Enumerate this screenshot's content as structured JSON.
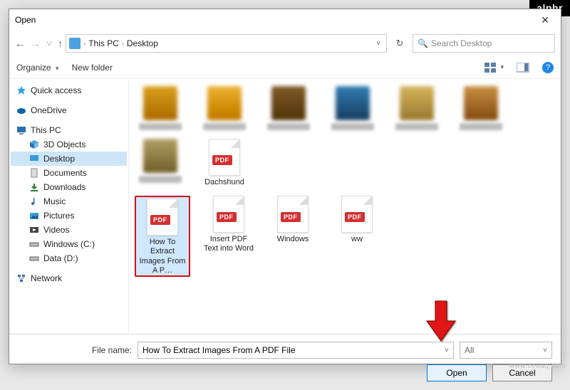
{
  "watermarks": {
    "alphr": "alphr",
    "site": "www.ceuaq.com"
  },
  "window": {
    "title": "Open"
  },
  "nav": {
    "path_icon": "monitor",
    "crumbs": [
      "This PC",
      "Desktop"
    ],
    "refresh_icon": "refresh"
  },
  "search": {
    "placeholder": "Search Desktop",
    "icon": "search-icon"
  },
  "toolbar": {
    "organize": "Organize",
    "new_folder": "New folder",
    "view_icon": "view-options",
    "preview_icon": "preview-pane",
    "help_icon": "?",
    "organize_caret": "▾"
  },
  "sidebar": {
    "groups": [
      {
        "icon": "star",
        "label": "Quick access",
        "color": "#2e87d4"
      },
      {
        "icon": "cloud",
        "label": "OneDrive",
        "color": "#0a63a8"
      },
      {
        "icon": "pc",
        "label": "This PC",
        "color": "#2b6fb3",
        "expanded": true,
        "children": [
          {
            "icon": "cube",
            "label": "3D Objects"
          },
          {
            "icon": "desktop",
            "label": "Desktop",
            "selected": true
          },
          {
            "icon": "doc",
            "label": "Documents"
          },
          {
            "icon": "down",
            "label": "Downloads"
          },
          {
            "icon": "music",
            "label": "Music"
          },
          {
            "icon": "pic",
            "label": "Pictures"
          },
          {
            "icon": "vid",
            "label": "Videos"
          },
          {
            "icon": "drive",
            "label": "Windows (C:)"
          },
          {
            "icon": "drive",
            "label": "Data (D:)"
          }
        ]
      },
      {
        "icon": "net",
        "label": "Network",
        "color": "#2b6fb3"
      }
    ]
  },
  "files": {
    "row1": [
      {
        "type": "folder",
        "label": ""
      },
      {
        "type": "folder",
        "label": ""
      },
      {
        "type": "folder",
        "label": ""
      },
      {
        "type": "folder",
        "label": ""
      },
      {
        "type": "folder",
        "label": ""
      },
      {
        "type": "folder",
        "label": ""
      },
      {
        "type": "folder",
        "label": ""
      },
      {
        "type": "pdf",
        "label": "Dachshund"
      }
    ],
    "row2": [
      {
        "type": "pdf",
        "label": "How To Extract Images From A P…",
        "selected": true
      },
      {
        "type": "pdf",
        "label": "Insert PDF Text into Word"
      },
      {
        "type": "pdf",
        "label": "Windows"
      },
      {
        "type": "pdf",
        "label": "ww"
      }
    ]
  },
  "footer": {
    "file_name_label": "File name:",
    "file_name_value": "How To Extract Images From A PDF File",
    "filter_value": "All",
    "open": "Open",
    "cancel": "Cancel"
  },
  "icon_glyphs": {
    "back": "←",
    "forward": "→",
    "up": "↑",
    "recent": "˅",
    "crumb_sep": "›",
    "dropdown": "˅",
    "refresh": "↻",
    "search": "🔍"
  }
}
